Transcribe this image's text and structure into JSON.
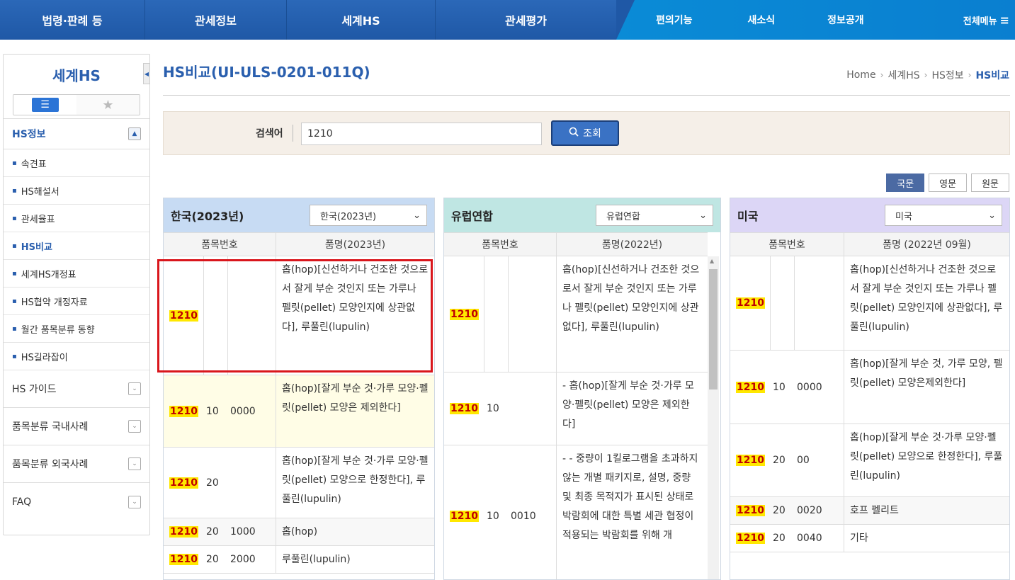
{
  "topnav": {
    "main_items": [
      "법령·판례 등",
      "관세정보",
      "세계HS",
      "관세평가"
    ],
    "sub_items": [
      "편의기능",
      "새소식",
      "정보공개"
    ],
    "all_menu": "전체메뉴",
    "all_menu_icon": "hamburger-icon"
  },
  "sidebar": {
    "title": "세계HS",
    "section": "HS정보",
    "sub_items": [
      "속견표",
      "HS해설서",
      "관세율표",
      "HS비교",
      "세계HS개정표",
      "HS협약 개정자료",
      "월간 품목분류 동향",
      "HS길라잡이"
    ],
    "active_item": "HS비교",
    "groups": [
      "HS 가이드",
      "품목분류 국내사례",
      "품목분류 외국사례",
      "FAQ"
    ]
  },
  "page": {
    "title": "HS비교(UI-ULS-0201-011Q)",
    "breadcrumb": [
      "Home",
      "세계HS",
      "HS정보",
      "HS비교"
    ]
  },
  "search": {
    "label": "검색어",
    "value": "1210",
    "button": "조회"
  },
  "lang_tabs": [
    "국문",
    "영문",
    "원문"
  ],
  "panels": {
    "korea": {
      "name": "한국(2023년)",
      "select": "한국(2023년)",
      "col_code": "품목번호",
      "col_desc": "품명(2023년)",
      "rows": [
        {
          "hs": "1210",
          "sub": "",
          "nat": "",
          "desc": "홉(hop)[신선하거나 건조한 것으로서 잘게 부순 것인지 또는 가루나 펠릿(pellet) 모양인지에 상관없다], 루풀린(lupulin)"
        },
        {
          "hs": "1210",
          "sub": "10",
          "nat": "0000",
          "desc": "홉(hop)[잘게 부순 것·가루 모양·펠릿(pellet) 모양은 제외한다]"
        },
        {
          "hs": "1210",
          "sub": "20",
          "nat": "",
          "desc": "홉(hop)[잘게 부순 것·가루 모양·펠릿(pellet) 모양으로 한정한다], 루풀린(lupulin)"
        },
        {
          "hs": "1210",
          "sub": "20",
          "nat": "1000",
          "desc": "홉(hop)"
        },
        {
          "hs": "1210",
          "sub": "20",
          "nat": "2000",
          "desc": "루풀린(lupulin)"
        }
      ]
    },
    "eu": {
      "name": "유럽연합",
      "select": "유럽연합",
      "col_code": "품목번호",
      "col_desc": "품명(2022년)",
      "rows": [
        {
          "hs": "1210",
          "sub": "",
          "nat": "",
          "desc": "홉(hop)[신선하거나 건조한 것으로서 잘게 부순 것인지 또는 가루나 펠릿(pellet) 모양인지에 상관없다], 루풀린(lupulin)"
        },
        {
          "hs": "1210",
          "sub": "10",
          "nat": "",
          "desc": "- 홉(hop)[잘게 부순 것·가루 모양·펠릿(pellet) 모양은 제외한다]"
        },
        {
          "hs": "1210",
          "sub": "10",
          "nat": "0010",
          "desc": "- - 중량이 1킬로그램을 초과하지 않는 개별 패키지로, 설명, 중량 및 최종 목적지가 표시된 상태로 박람회에 대한 특별 세관 협정이 적용되는 박람회를 위해 개"
        }
      ]
    },
    "us": {
      "name": "미국",
      "select": "미국",
      "col_code": "품목번호",
      "col_desc": "품명 (2022년 09월)",
      "rows": [
        {
          "hs": "1210",
          "sub": "",
          "nat": "",
          "desc": "홉(hop)[신선하거나 건조한 것으로서 잘게 부순 것인지 또는 가루나 펠릿(pellet) 모양인지에 상관없다], 루풀린(lupulin)"
        },
        {
          "hs": "1210",
          "sub": "10",
          "nat": "0000",
          "desc": "홉(hop)[잘게 부순 것, 가루 모양, 펠릿(pellet) 모양은제외한다]"
        },
        {
          "hs": "1210",
          "sub": "20",
          "nat": "00",
          "desc": "홉(hop)[잘게 부순 것·가루 모양·펠릿(pellet) 모양으로 한정한다], 루풀린(lupulin)"
        },
        {
          "hs": "1210",
          "sub": "20",
          "nat": "0020",
          "desc": "호프 펠리트"
        },
        {
          "hs": "1210",
          "sub": "20",
          "nat": "0040",
          "desc": "기타"
        }
      ]
    }
  },
  "colors": {
    "nav_blue": "#1f58a6",
    "nav_cyan": "#0a85d3",
    "panel_korea": "#c7dbf3",
    "panel_eu": "#bfe6e3",
    "panel_us": "#dcd6f6",
    "highlight": "#ffe800",
    "annotation_red": "#d9161c"
  }
}
